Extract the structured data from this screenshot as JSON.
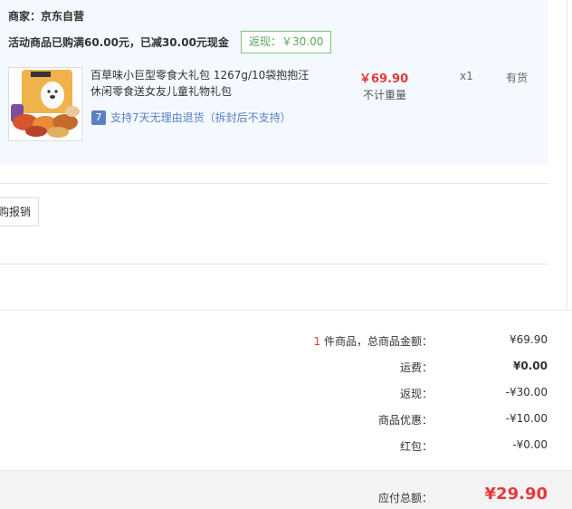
{
  "shop": {
    "merchant": "商家：京东自营",
    "promo_text": "活动商品已购满60.00元，已减30.00元现金",
    "rebate_tag": "返现：￥30.00"
  },
  "product": {
    "name": "百草味小巨型零食大礼包 1267g/10袋抱抱汪休闲零食送女友儿童礼物礼包",
    "return_icon": "7",
    "return_policy": "支持7天无理由退货（拆封后不支持）",
    "price": "￥69.90",
    "weight": "不计重量",
    "quantity": "x1",
    "stock": "有货",
    "image_icon": "snack-gift-box-image"
  },
  "invoice": {
    "button_label": "购报销"
  },
  "summary": {
    "item_count": "1",
    "item_count_suffix": " 件商品，总商品金额：",
    "items_total": "¥69.90",
    "shipping_label": "运费：",
    "shipping_value": "¥0.00",
    "rebate_label": "返现：",
    "rebate_value": "-¥30.00",
    "discount_label": "商品优惠：",
    "discount_value": "-¥10.00",
    "redpacket_label": "红包：",
    "redpacket_value": "-¥0.00",
    "total_label": "应付总额：",
    "total_value": "¥29.90"
  },
  "colors": {
    "price_red": "#e4393c",
    "panel_bg": "#f3f9fe",
    "rebate_green": "#5aa85a",
    "link_blue": "#5b7fc7"
  }
}
